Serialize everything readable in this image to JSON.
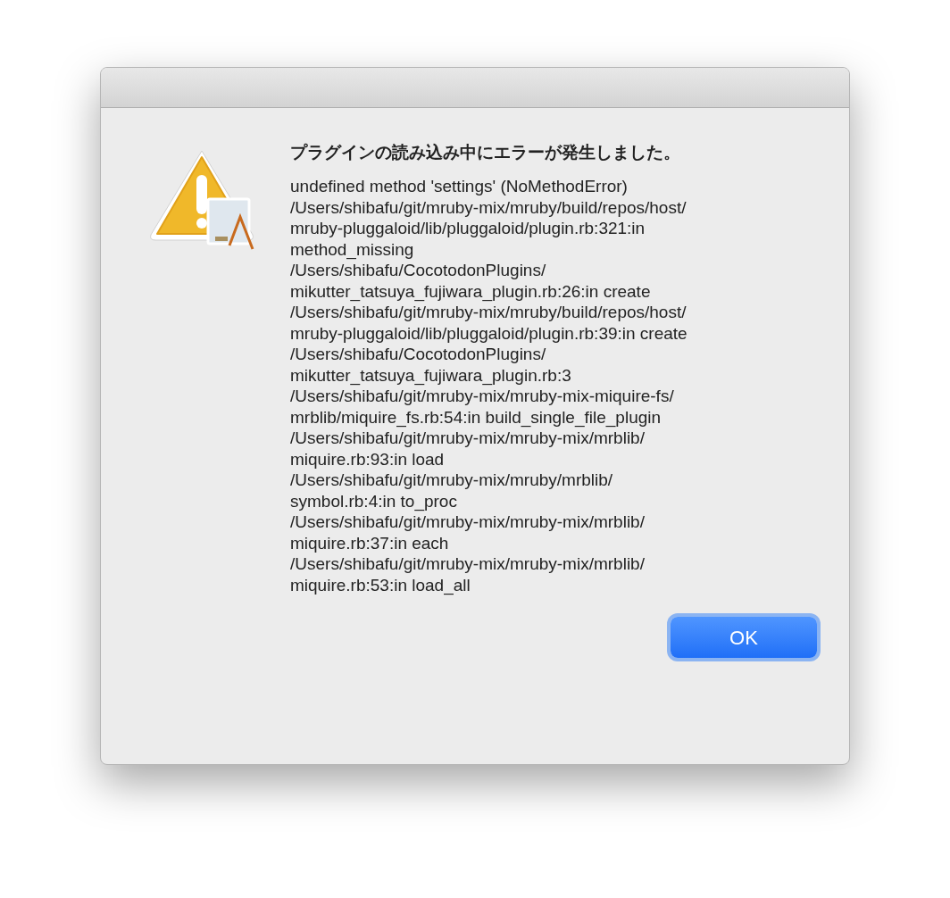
{
  "dialog": {
    "title": "プラグインの読み込み中にエラーが発生しました。",
    "message_lines": [
      "undefined method 'settings' (NoMethodError)",
      "/Users/shibafu/git/mruby-mix/mruby/build/repos/host/",
      "mruby-pluggaloid/lib/pluggaloid/plugin.rb:321:in",
      "method_missing",
      "/Users/shibafu/CocotodonPlugins/",
      "mikutter_tatsuya_fujiwara_plugin.rb:26:in create",
      "/Users/shibafu/git/mruby-mix/mruby/build/repos/host/",
      "mruby-pluggaloid/lib/pluggaloid/plugin.rb:39:in create",
      "/Users/shibafu/CocotodonPlugins/",
      "mikutter_tatsuya_fujiwara_plugin.rb:3",
      "/Users/shibafu/git/mruby-mix/mruby-mix-miquire-fs/",
      "mrblib/miquire_fs.rb:54:in build_single_file_plugin",
      "/Users/shibafu/git/mruby-mix/mruby-mix/mrblib/",
      "miquire.rb:93:in load",
      "/Users/shibafu/git/mruby-mix/mruby/mrblib/",
      "symbol.rb:4:in to_proc",
      "/Users/shibafu/git/mruby-mix/mruby-mix/mrblib/",
      "miquire.rb:37:in each",
      "/Users/shibafu/git/mruby-mix/mruby-mix/mrblib/",
      "miquire.rb:53:in load_all"
    ],
    "buttons": [
      {
        "label": "OK",
        "default": true
      }
    ]
  }
}
